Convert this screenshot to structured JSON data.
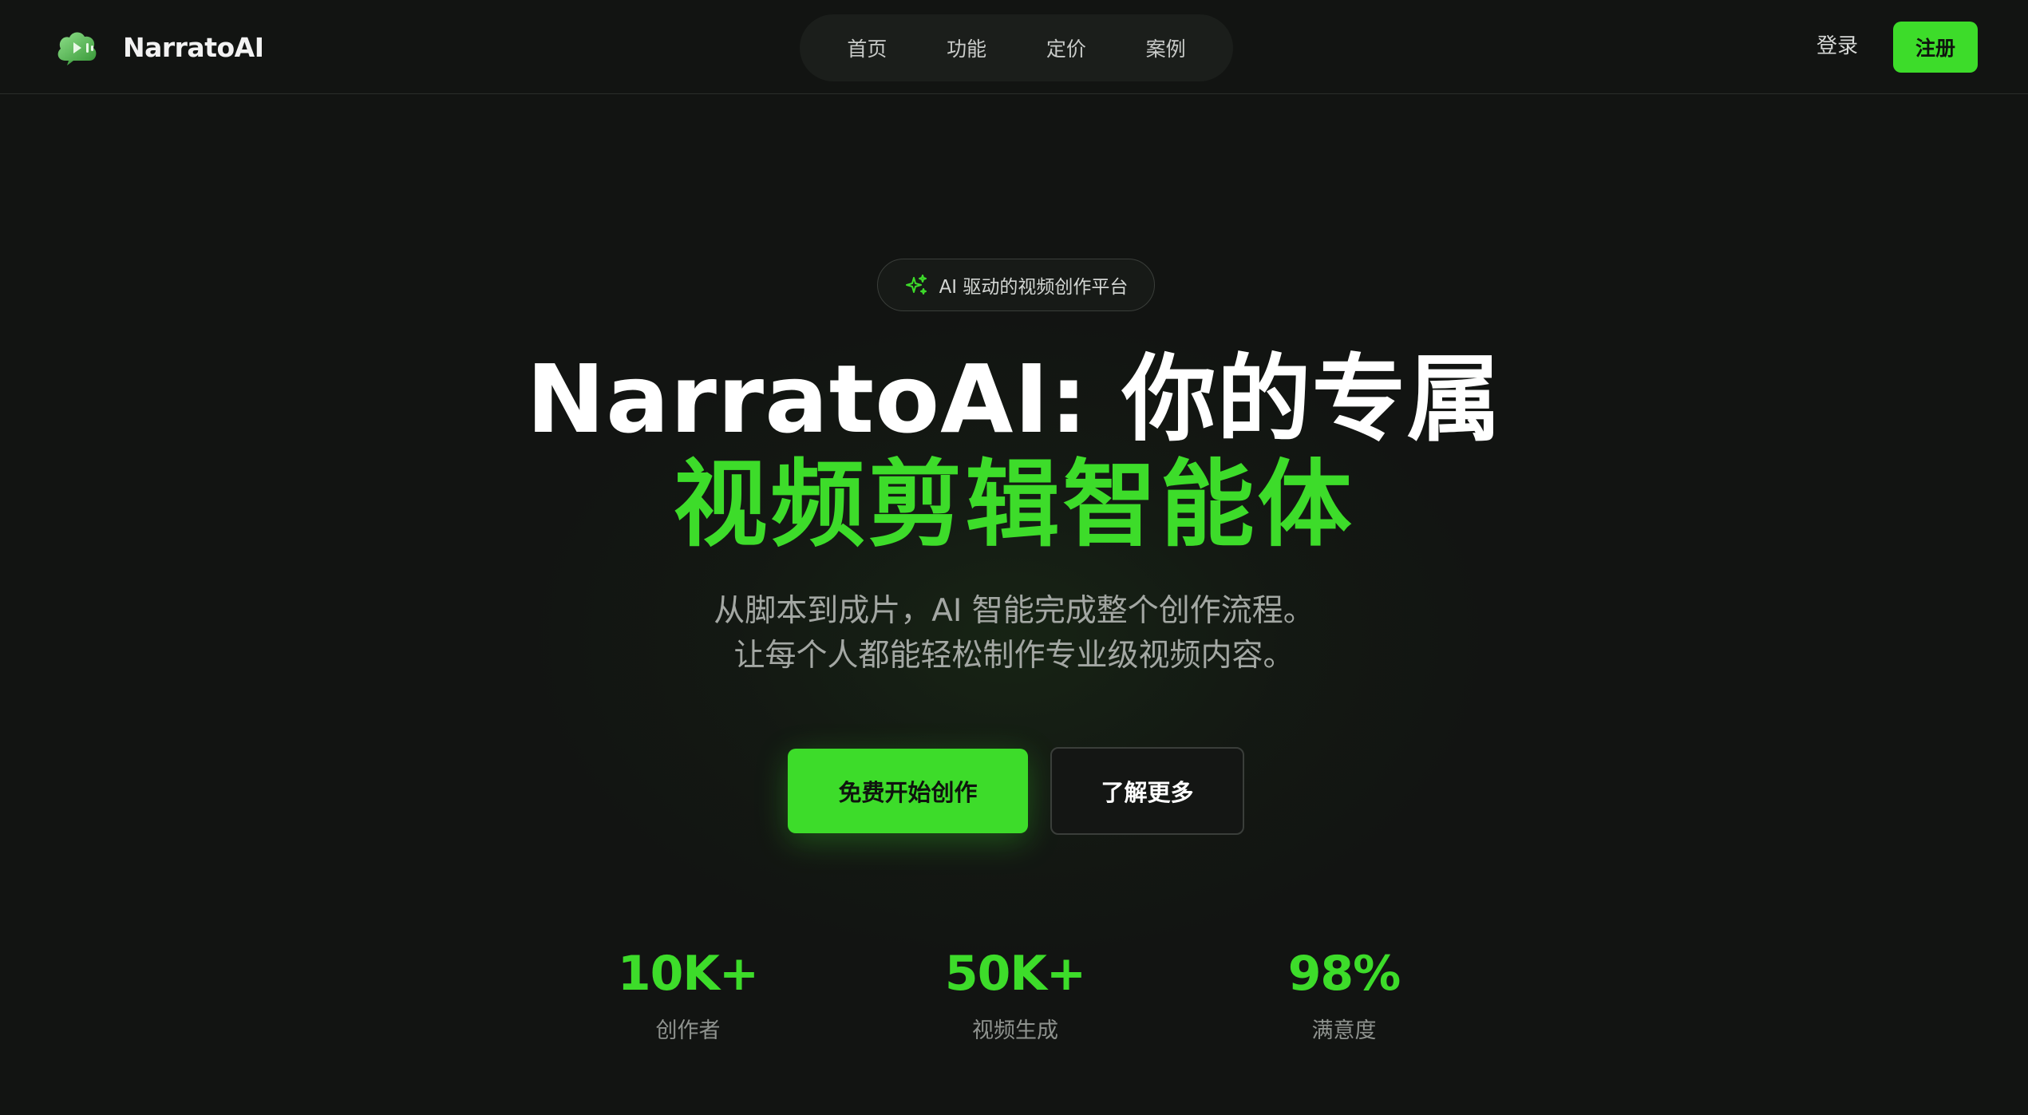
{
  "brand": {
    "name": "NarratoAI",
    "accent_color": "#3ddc2a",
    "logo_icon": "video-cloud-icon"
  },
  "nav": {
    "items": [
      {
        "label": "首页"
      },
      {
        "label": "功能"
      },
      {
        "label": "定价"
      },
      {
        "label": "案例"
      }
    ],
    "login_label": "登录",
    "signup_label": "注册"
  },
  "hero": {
    "badge_icon": "sparkles-icon",
    "badge_text": "AI 驱动的视频创作平台",
    "title_line1": "NarratoAI: 你的专属",
    "title_line2": "视频剪辑智能体",
    "subtitle_line1": "从脚本到成片，AI 智能完成整个创作流程。",
    "subtitle_line2": "让每个人都能轻松制作专业级视频内容。",
    "primary_cta": "免费开始创作",
    "secondary_cta": "了解更多"
  },
  "stats": [
    {
      "value": "10K+",
      "label": "创作者"
    },
    {
      "value": "50K+",
      "label": "视频生成"
    },
    {
      "value": "98%",
      "label": "满意度"
    }
  ]
}
